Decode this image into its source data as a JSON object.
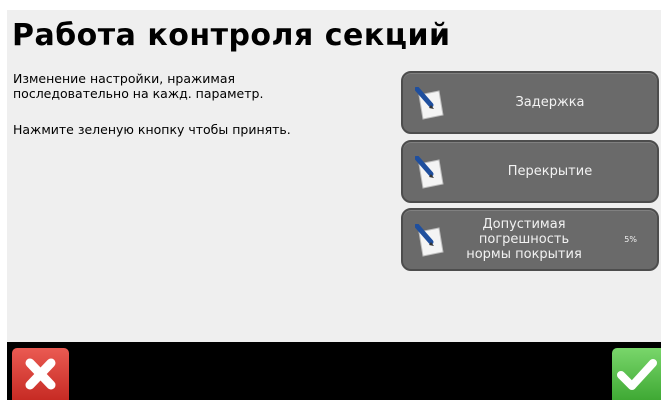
{
  "title": "Работа контроля секций",
  "instructions": [
    "Изменение настройки, нражимая последовательно на кажд. параметр.",
    "Нажмите зеленую кнопку чтобы принять."
  ],
  "options": [
    {
      "label": "Задержка",
      "value": ""
    },
    {
      "label": "Перекрытие",
      "value": ""
    },
    {
      "label": "Допустимая\nпогрешность\nнормы покрытия",
      "value": "5%"
    }
  ],
  "icons": {
    "option": "edit-pencil-icon",
    "cancel": "close-icon",
    "accept": "check-icon"
  },
  "colors": {
    "cancel": "#d9362e",
    "accept": "#5cc24e",
    "option_bg": "#6a6a6a"
  }
}
